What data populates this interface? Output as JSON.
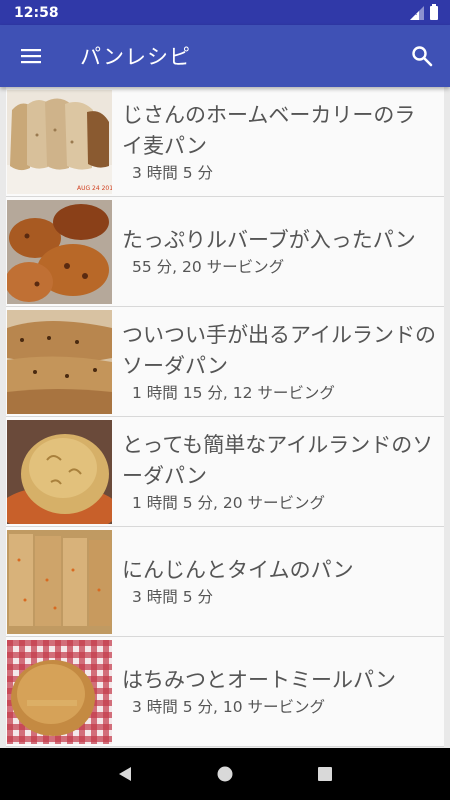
{
  "status_bar": {
    "time": "12:58"
  },
  "app_bar": {
    "title": "パンレシピ"
  },
  "recipes": [
    {
      "title": "じさんのホームベーカリーのライ麦パン",
      "meta": "3 時間 5 分"
    },
    {
      "title": "たっぷりルバーブが入ったパン",
      "meta": "55 分, 20 サービング"
    },
    {
      "title": "ついつい手が出るアイルランドのソーダパン",
      "meta": "1 時間 15 分, 12 サービング"
    },
    {
      "title": "とっても簡単なアイルランドのソーダパン",
      "meta": "1 時間 5 分, 20 サービング"
    },
    {
      "title": "にんじんとタイムのパン",
      "meta": "3 時間 5 分"
    },
    {
      "title": "はちみつとオートミールパン",
      "meta": "3 時間 5 分, 10 サービング"
    }
  ],
  "colors": {
    "status_bar": "#3039a8",
    "app_bar": "#3f51b5",
    "list_bg": "#fafafa",
    "text": "#555555"
  },
  "icons": [
    "menu-icon",
    "search-icon",
    "signal-icon",
    "battery-icon",
    "back-icon",
    "home-icon",
    "recents-icon"
  ]
}
